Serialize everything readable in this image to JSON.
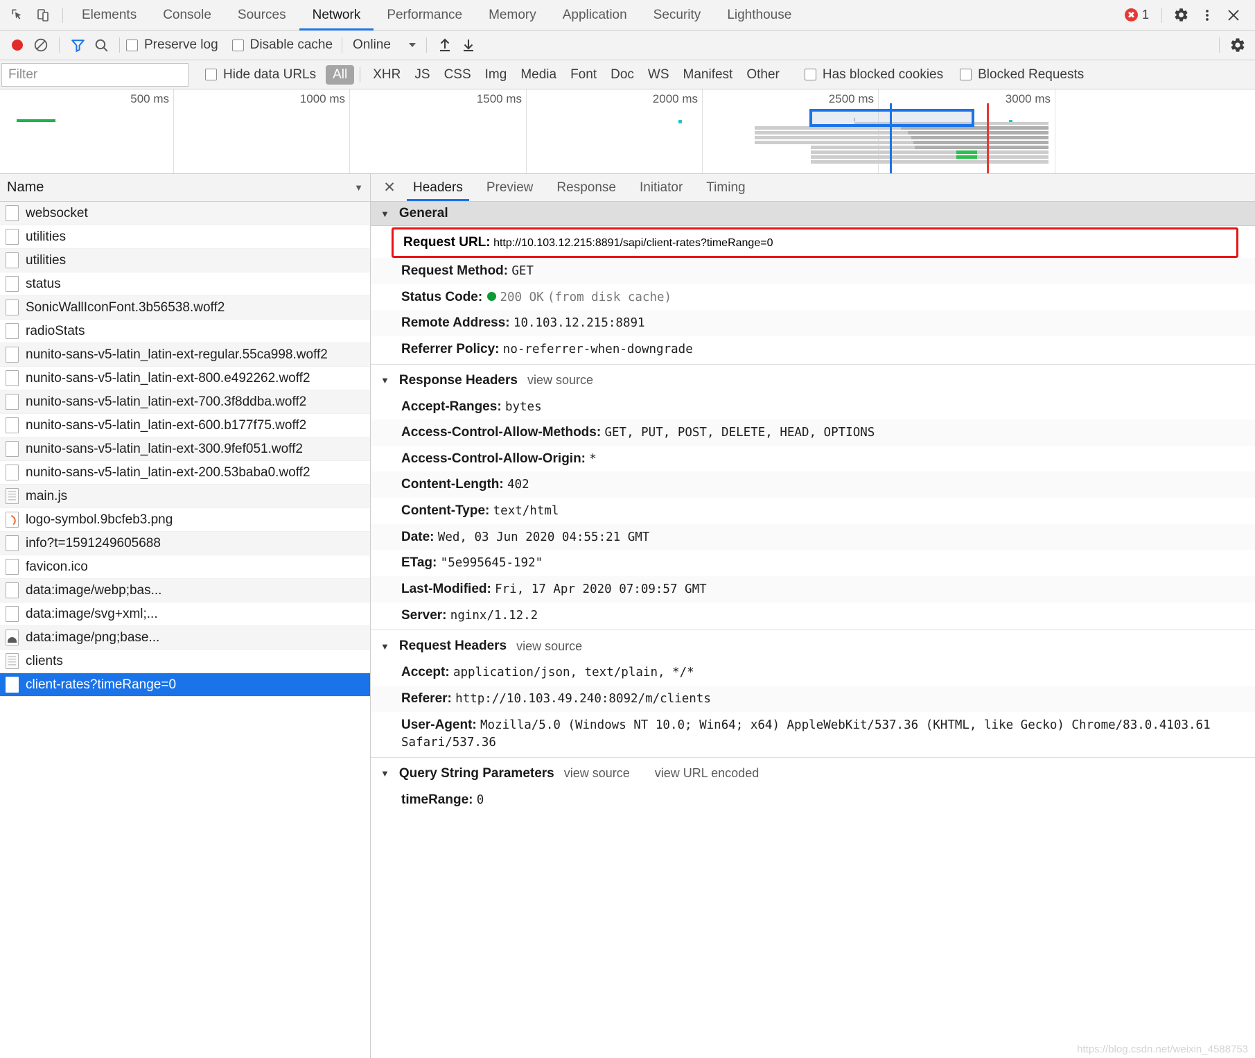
{
  "tabbar": {
    "icons": [
      {
        "name": "inspect-element-icon"
      },
      {
        "name": "device-toolbar-icon"
      }
    ],
    "tabs": [
      {
        "label": "Elements",
        "active": false
      },
      {
        "label": "Console",
        "active": false
      },
      {
        "label": "Sources",
        "active": false
      },
      {
        "label": "Network",
        "active": true
      },
      {
        "label": "Performance",
        "active": false
      },
      {
        "label": "Memory",
        "active": false
      },
      {
        "label": "Application",
        "active": false
      },
      {
        "label": "Security",
        "active": false
      },
      {
        "label": "Lighthouse",
        "active": false
      }
    ],
    "error_count": "1",
    "error_icon": "error-badge-icon",
    "settings_icon": "gear-icon",
    "more_icon": "kebab-menu-icon",
    "close_icon": "close-icon"
  },
  "toolbar": {
    "record_label": "record-button",
    "clear_label": "clear-button",
    "filter_toggle_label": "filter-toggle-button",
    "search_label": "search-button",
    "preserve_log": {
      "label": "Preserve log",
      "checked": false
    },
    "disable_cache": {
      "label": "Disable cache",
      "checked": false
    },
    "throttling": {
      "value": "Online"
    },
    "import_label": "import-har-button",
    "export_label": "export-har-button",
    "settings_label": "network-settings-button"
  },
  "filterbar": {
    "filter_placeholder": "Filter",
    "filter_value": "",
    "hide_data_urls": {
      "label": "Hide data URLs",
      "checked": false
    },
    "types": [
      {
        "label": "All",
        "active": true
      },
      {
        "label": "XHR",
        "active": false
      },
      {
        "label": "JS",
        "active": false
      },
      {
        "label": "CSS",
        "active": false
      },
      {
        "label": "Img",
        "active": false
      },
      {
        "label": "Media",
        "active": false
      },
      {
        "label": "Font",
        "active": false
      },
      {
        "label": "Doc",
        "active": false
      },
      {
        "label": "WS",
        "active": false
      },
      {
        "label": "Manifest",
        "active": false
      },
      {
        "label": "Other",
        "active": false
      }
    ],
    "has_blocked_cookies": {
      "label": "Has blocked cookies",
      "checked": false
    },
    "blocked_requests": {
      "label": "Blocked Requests",
      "checked": false
    }
  },
  "overview": {
    "ticks": [
      "500 ms",
      "1000 ms",
      "1500 ms",
      "2000 ms",
      "2500 ms",
      "3000 ms"
    ]
  },
  "requests": {
    "column_header": "Name",
    "sort_icon": "chevron-down-icon",
    "rows": [
      {
        "name": "websocket",
        "icon": "doc-icon",
        "selected": false
      },
      {
        "name": "utilities",
        "icon": "doc-icon",
        "selected": false
      },
      {
        "name": "utilities",
        "icon": "doc-icon",
        "selected": false
      },
      {
        "name": "status",
        "icon": "doc-icon",
        "selected": false
      },
      {
        "name": "SonicWallIconFont.3b56538.woff2",
        "icon": "doc-icon",
        "selected": false
      },
      {
        "name": "radioStats",
        "icon": "doc-icon",
        "selected": false
      },
      {
        "name": "nunito-sans-v5-latin_latin-ext-regular.55ca998.woff2",
        "icon": "doc-icon",
        "selected": false
      },
      {
        "name": "nunito-sans-v5-latin_latin-ext-800.e492262.woff2",
        "icon": "doc-icon",
        "selected": false
      },
      {
        "name": "nunito-sans-v5-latin_latin-ext-700.3f8ddba.woff2",
        "icon": "doc-icon",
        "selected": false
      },
      {
        "name": "nunito-sans-v5-latin_latin-ext-600.b177f75.woff2",
        "icon": "doc-icon",
        "selected": false
      },
      {
        "name": "nunito-sans-v5-latin_latin-ext-300.9fef051.woff2",
        "icon": "doc-icon",
        "selected": false
      },
      {
        "name": "nunito-sans-v5-latin_latin-ext-200.53baba0.woff2",
        "icon": "doc-icon",
        "selected": false
      },
      {
        "name": "main.js",
        "icon": "script-icon",
        "selected": false
      },
      {
        "name": "logo-symbol.9bcfeb3.png",
        "icon": "image-icon",
        "selected": false
      },
      {
        "name": "info?t=1591249605688",
        "icon": "doc-icon",
        "selected": false
      },
      {
        "name": "favicon.ico",
        "icon": "doc-icon",
        "selected": false
      },
      {
        "name": "data:image/webp;bas...",
        "icon": "doc-icon",
        "selected": false
      },
      {
        "name": "data:image/svg+xml;...",
        "icon": "doc-icon",
        "selected": false
      },
      {
        "name": "data:image/png;base...",
        "icon": "image-png-icon",
        "selected": false
      },
      {
        "name": "clients",
        "icon": "script-icon",
        "selected": false
      },
      {
        "name": "client-rates?timeRange=0",
        "icon": "doc-icon",
        "selected": true
      }
    ]
  },
  "details": {
    "close_icon": "close-icon",
    "tabs": [
      {
        "label": "Headers",
        "active": true
      },
      {
        "label": "Preview",
        "active": false
      },
      {
        "label": "Response",
        "active": false
      },
      {
        "label": "Initiator",
        "active": false
      },
      {
        "label": "Timing",
        "active": false
      }
    ],
    "general": {
      "title": "General",
      "request_url_label": "Request URL:",
      "request_url_value": "http://10.103.12.215:8891/sapi/client-rates?timeRange=0",
      "highlight_color": "#e81313",
      "items": [
        {
          "label": "Request Method:",
          "value": "GET"
        },
        {
          "label": "Remote Address:",
          "value": "10.103.12.215:8891"
        },
        {
          "label": "Referrer Policy:",
          "value": "no-referrer-when-downgrade"
        }
      ],
      "status_label": "Status Code:",
      "status_code": "200 OK",
      "status_extra": "(from disk cache)",
      "status_color": "#0b9a36"
    },
    "response_headers": {
      "title": "Response Headers",
      "view_source": "view source",
      "items": [
        {
          "label": "Accept-Ranges:",
          "value": "bytes"
        },
        {
          "label": "Access-Control-Allow-Methods:",
          "value": "GET, PUT, POST, DELETE, HEAD, OPTIONS"
        },
        {
          "label": "Access-Control-Allow-Origin:",
          "value": "*"
        },
        {
          "label": "Content-Length:",
          "value": "402"
        },
        {
          "label": "Content-Type:",
          "value": "text/html"
        },
        {
          "label": "Date:",
          "value": "Wed, 03 Jun 2020 04:55:21 GMT"
        },
        {
          "label": "ETag:",
          "value": "\"5e995645-192\""
        },
        {
          "label": "Last-Modified:",
          "value": "Fri, 17 Apr 2020 07:09:57 GMT"
        },
        {
          "label": "Server:",
          "value": "nginx/1.12.2"
        }
      ]
    },
    "request_headers": {
      "title": "Request Headers",
      "view_source": "view source",
      "items": [
        {
          "label": "Accept:",
          "value": "application/json, text/plain, */*"
        },
        {
          "label": "Referer:",
          "value": "http://10.103.49.240:8092/m/clients"
        },
        {
          "label": "User-Agent:",
          "value": "Mozilla/5.0 (Windows NT 10.0; Win64; x64) AppleWebKit/537.36 (KHTML, like Gecko) Chrome/83.0.4103.61 Safari/537.36"
        }
      ]
    },
    "query_string": {
      "title": "Query String Parameters",
      "view_source": "view source",
      "view_url_encoded": "view URL encoded",
      "items": [
        {
          "label": "timeRange:",
          "value": "0"
        }
      ]
    }
  },
  "watermark": "https://blog.csdn.net/weixin_4588753"
}
